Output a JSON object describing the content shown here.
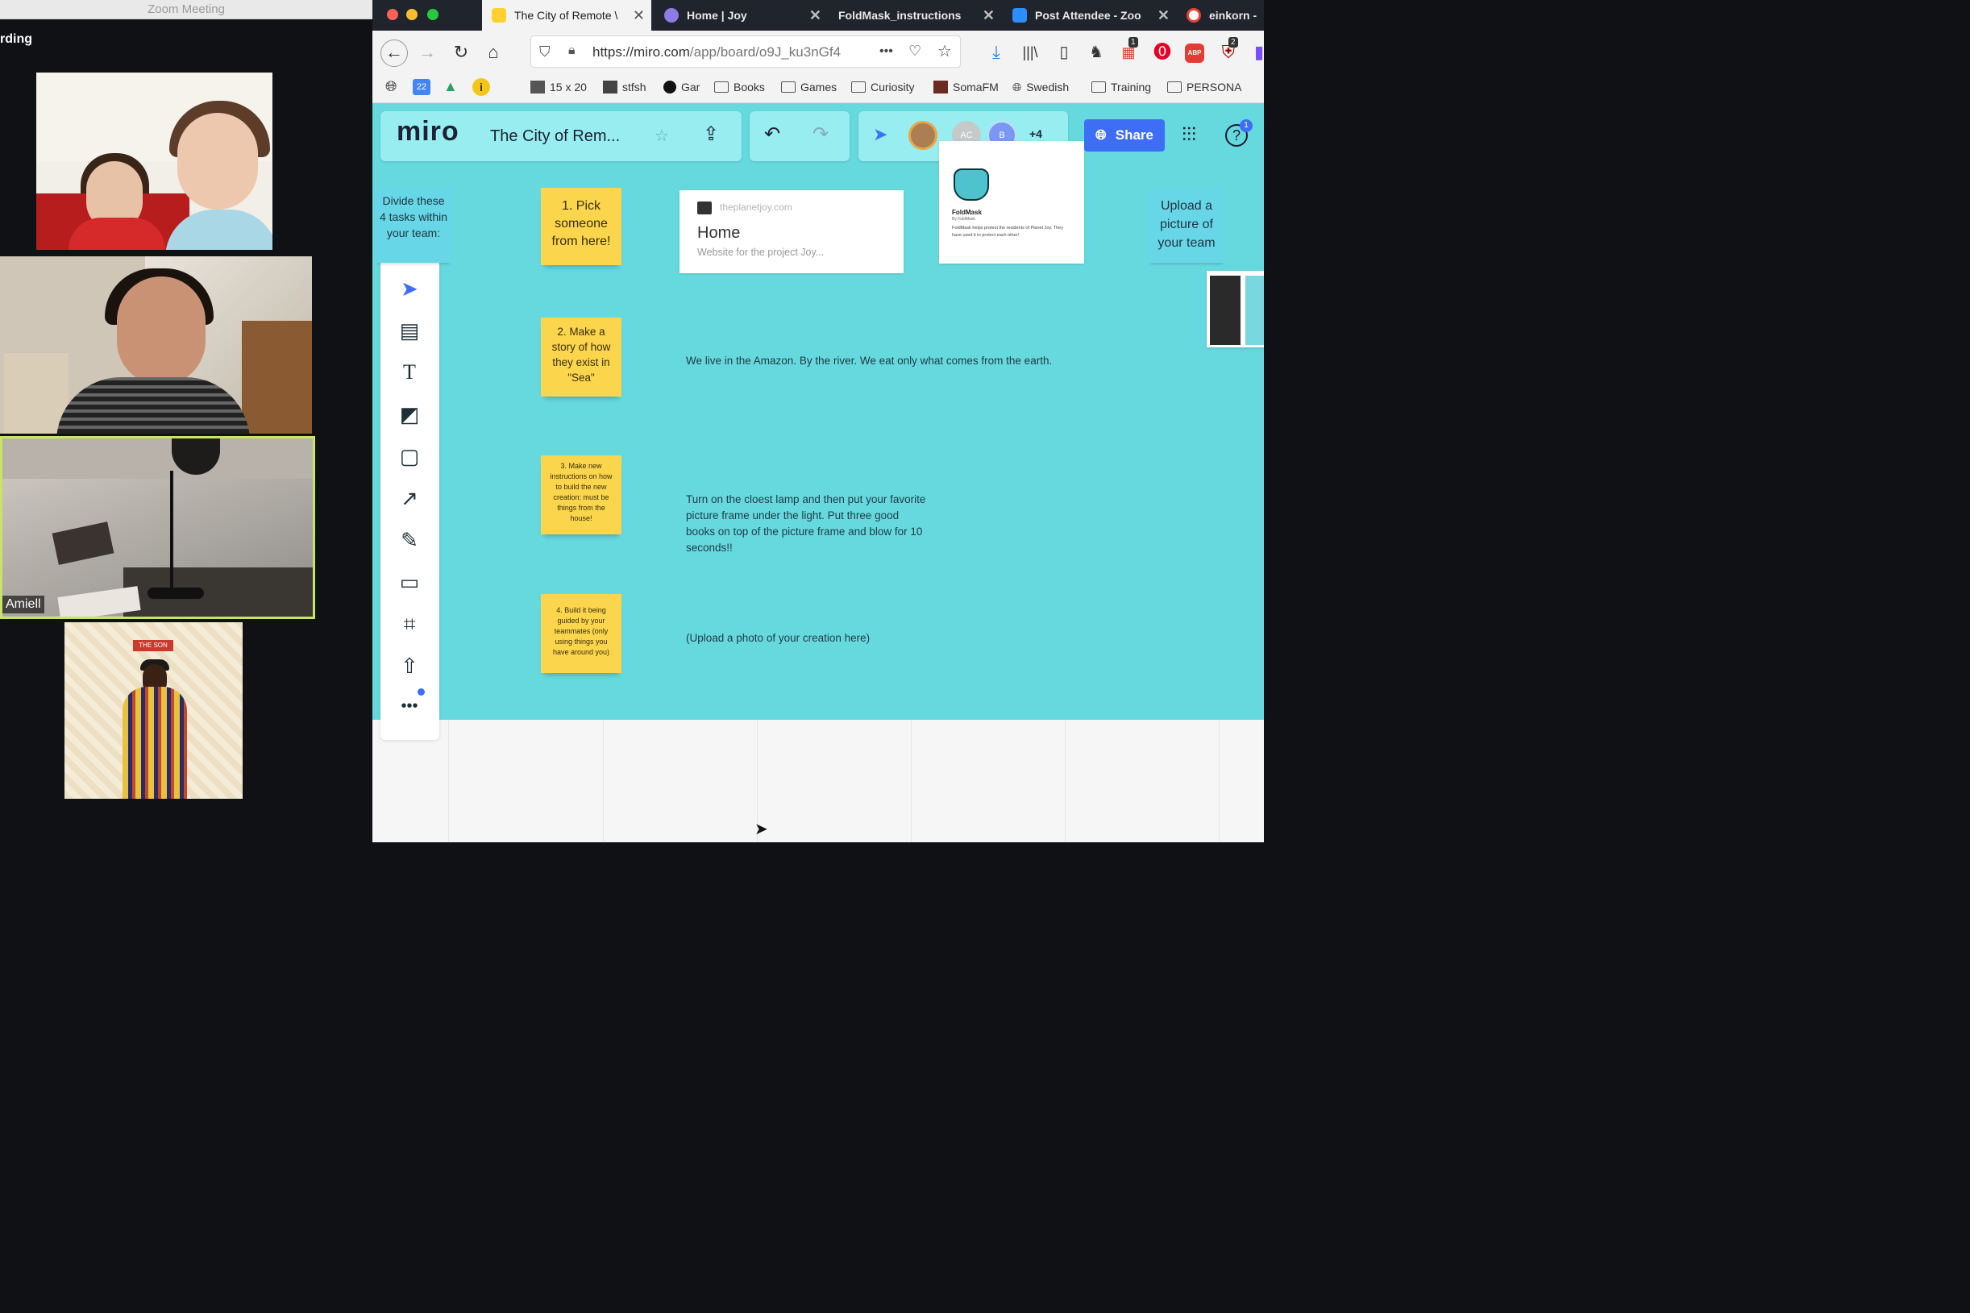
{
  "zoom": {
    "window_title": "Zoom Meeting",
    "recording_label": "rding",
    "active_speaker_name": "Amiell",
    "poster_text": "THE SON"
  },
  "browser": {
    "tabs": [
      {
        "label": "The City of Remote \\",
        "active": true
      },
      {
        "label": "Home | Joy",
        "active": false
      },
      {
        "label": "FoldMask_instructions",
        "active": false
      },
      {
        "label": "Post Attendee - Zoo",
        "active": false
      },
      {
        "label": "einkorn -",
        "active": false
      }
    ],
    "url_main": "https://miro.com",
    "url_path": "/app/board/o9J_ku3nGf4",
    "url_more": "•••",
    "badges": {
      "ext1": "1",
      "ext2": "2",
      "abp": "ABP"
    },
    "bookmarks": [
      {
        "label": "15 x 20",
        "icon": "image-icon"
      },
      {
        "label": "stfsh",
        "icon": "image-icon"
      },
      {
        "label": "Gar",
        "icon": "circle-icon"
      },
      {
        "label": "Books",
        "icon": "folder-icon"
      },
      {
        "label": "Games",
        "icon": "folder-icon"
      },
      {
        "label": "Curiosity",
        "icon": "folder-icon"
      },
      {
        "label": "SomaFM",
        "icon": "image-icon"
      },
      {
        "label": "Swedish",
        "icon": "globe-icon"
      },
      {
        "label": "Training",
        "icon": "folder-icon"
      },
      {
        "label": "PERSONA",
        "icon": "folder-icon"
      }
    ],
    "calendar_day": "22"
  },
  "miro": {
    "logo": "miro",
    "board_title": "The City of Rem...",
    "avatars": [
      {
        "initials": "AC",
        "color": "#c9c9c9"
      },
      {
        "initials": "B",
        "color": "#7b95f2"
      }
    ],
    "more_collaborators": "+4",
    "share_label": "Share",
    "help_badge": "1",
    "instructions_card": "Divide these 4 tasks within your team:",
    "upload_card": "Upload a picture of your team",
    "stickies": [
      {
        "text": "1. Pick someone from here!"
      },
      {
        "text": "2. Make a story of how they exist in \"Sea\""
      },
      {
        "text": "3. Make new instructions on how to build the new creation: must be things from the house!"
      },
      {
        "text": "4. Build it being guided by your teammates (only using things you have around you)"
      }
    ],
    "texts": [
      "We live in the Amazon. By the river. We eat only what comes from the earth.",
      "Turn on the cloest lamp and then put your favorite picture frame under the light. Put three good books on top of the picture frame and blow for 10 seconds!!",
      "(Upload a photo of your creation here)"
    ],
    "web_card": {
      "domain": "theplanetjoy.com",
      "title": "Home",
      "description": "Website for the project Joy..."
    },
    "fold_card": {
      "title": "FoldMask",
      "subtitle": "By FoldMask",
      "body": "FoldMask helps protect the residents of Planet Joy. They have used it to protect each other!"
    }
  },
  "colors": {
    "teal_canvas": "#66d9df",
    "sticky_yellow": "#fbd54c",
    "share_blue": "#3e6df6",
    "active_speaker_border": "#c8e466"
  }
}
